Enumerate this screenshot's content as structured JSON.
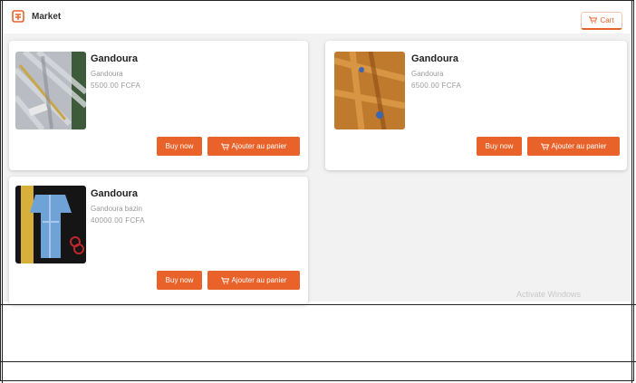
{
  "header": {
    "brand": "Market",
    "cart_label": "Cart",
    "logo_icon": "store-logo-icon",
    "cart_icon": "cart-icon"
  },
  "colors": {
    "accent": "#e8622a",
    "background": "#f2f2f2"
  },
  "products": [
    {
      "title": "Gandoura",
      "category": "Gandoura",
      "price": "5500.00 FCFA",
      "buy_label": "Buy now",
      "add_label": "Ajouter au panier"
    },
    {
      "title": "Gandoura",
      "category": "Gandoura",
      "price": "6500.00 FCFA",
      "buy_label": "Buy now",
      "add_label": "Ajouter au panier"
    },
    {
      "title": "Gandoura",
      "category": "Gandoura bazin",
      "price": "40000.00 FCFA",
      "buy_label": "Buy now",
      "add_label": "Ajouter au panier"
    }
  ],
  "watermark": "Activate Windows"
}
